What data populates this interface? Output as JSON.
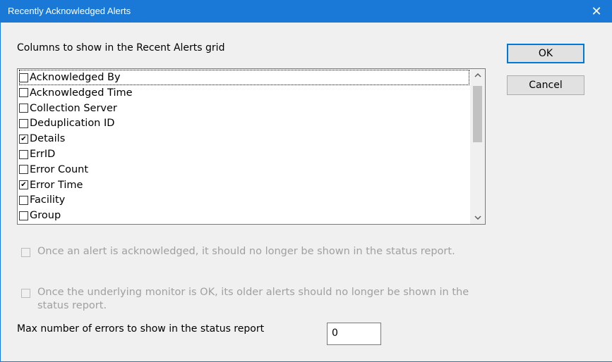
{
  "window": {
    "title": "Recently Acknowledged Alerts",
    "close_glyph": "✕"
  },
  "columns_label": "Columns to show in the Recent Alerts grid",
  "columns": [
    {
      "label": "Acknowledged By",
      "checked": false,
      "focused": true
    },
    {
      "label": "Acknowledged Time",
      "checked": false
    },
    {
      "label": "Collection Server",
      "checked": false
    },
    {
      "label": "Deduplication ID",
      "checked": false
    },
    {
      "label": "Details",
      "checked": true
    },
    {
      "label": "ErrID",
      "checked": false
    },
    {
      "label": "Error Count",
      "checked": false
    },
    {
      "label": "Error Time",
      "checked": true
    },
    {
      "label": "Facility",
      "checked": false
    },
    {
      "label": "Group",
      "checked": false
    }
  ],
  "buttons": {
    "ok": "OK",
    "cancel": "Cancel"
  },
  "options": {
    "hide_acknowledged": "Once an alert is acknowledged, it should no longer be shown in the status report.",
    "hide_after_ok": "Once the underlying monitor is OK, its older alerts should no longer be shown in the status report."
  },
  "max_errors": {
    "label": "Max number of errors to show in the status report",
    "value": "0"
  },
  "icons": {
    "close": "close-icon",
    "scroll_up": "chevron-up-icon",
    "scroll_down": "chevron-down-icon",
    "checkmark": "checkmark-icon"
  },
  "colors": {
    "title_bar": "#1a78d6",
    "default_button_border": "#0078d7",
    "disabled_text": "#a0a0a0"
  }
}
